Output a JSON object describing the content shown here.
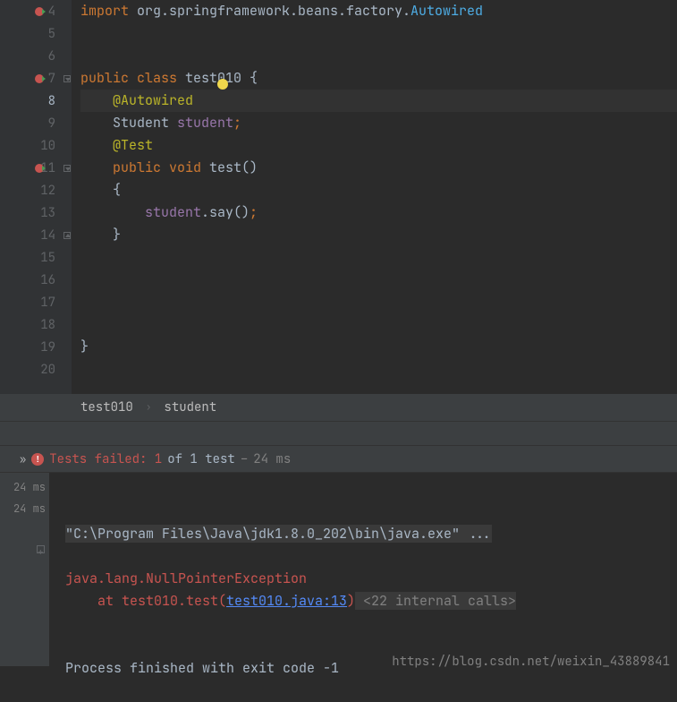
{
  "editor": {
    "lines": [
      {
        "num": 4,
        "run": true,
        "fold": null,
        "seg": [
          [
            "kw-orange",
            "import "
          ],
          [
            "kw-white",
            "org.springframework.beans.factory."
          ],
          [
            "kw-cyan",
            "Autowired"
          ]
        ]
      },
      {
        "num": 5,
        "run": false,
        "fold": null,
        "seg": []
      },
      {
        "num": 6,
        "run": false,
        "fold": null,
        "seg": []
      },
      {
        "num": 7,
        "run": true,
        "fold": "down",
        "seg": [
          [
            "kw-orange",
            "public class "
          ],
          [
            "kw-white",
            "test010 {"
          ]
        ]
      },
      {
        "num": 8,
        "run": false,
        "fold": null,
        "current": true,
        "seg": [
          [
            "kw-white",
            "    "
          ],
          [
            "kw-yellow",
            "@Autowired"
          ]
        ]
      },
      {
        "num": 9,
        "run": false,
        "fold": null,
        "seg": [
          [
            "kw-white",
            "    Student "
          ],
          [
            "kw-purple",
            "student"
          ],
          [
            "kw-orange",
            ";"
          ]
        ]
      },
      {
        "num": 10,
        "run": false,
        "fold": null,
        "seg": [
          [
            "kw-white",
            "    "
          ],
          [
            "kw-yellow",
            "@Test"
          ]
        ]
      },
      {
        "num": 11,
        "run": true,
        "fold": "down",
        "seg": [
          [
            "kw-white",
            "    "
          ],
          [
            "kw-orange",
            "public void "
          ],
          [
            "kw-white",
            "test()"
          ]
        ]
      },
      {
        "num": 12,
        "run": false,
        "fold": null,
        "seg": [
          [
            "kw-white",
            "    {"
          ]
        ]
      },
      {
        "num": 13,
        "run": false,
        "fold": null,
        "seg": [
          [
            "kw-white",
            "        "
          ],
          [
            "kw-purple",
            "student"
          ],
          [
            "kw-white",
            ".say()"
          ],
          [
            "kw-orange",
            ";"
          ]
        ]
      },
      {
        "num": 14,
        "run": false,
        "fold": "up",
        "seg": [
          [
            "kw-white",
            "    }"
          ]
        ]
      },
      {
        "num": 15,
        "run": false,
        "fold": null,
        "seg": []
      },
      {
        "num": 16,
        "run": false,
        "fold": null,
        "seg": []
      },
      {
        "num": 17,
        "run": false,
        "fold": null,
        "seg": []
      },
      {
        "num": 18,
        "run": false,
        "fold": null,
        "seg": []
      },
      {
        "num": 19,
        "run": false,
        "fold": null,
        "seg": [
          [
            "kw-white",
            "}"
          ]
        ]
      },
      {
        "num": 20,
        "run": false,
        "fold": null,
        "seg": []
      }
    ]
  },
  "breadcrumb": {
    "class": "test010",
    "field": "student",
    "sep": "›"
  },
  "test": {
    "chev": "»",
    "status": "Tests failed: 1",
    "of": " of 1 test ",
    "dash": "– ",
    "time": "24 ms"
  },
  "outputGutter": [
    "24 ms",
    "24 ms"
  ],
  "console": {
    "cmd": "\"C:\\Program Files\\Java\\jdk1.8.0_202\\bin\\java.exe\" ...",
    "blank1": "",
    "exc": "java.lang.NullPointerException",
    "at": "    at test010.test(",
    "link": "test010.java:13",
    "paren": ")",
    "internal": " <22 internal calls>",
    "blank2": "",
    "blank3": "",
    "exit": "Process finished with exit code -1"
  },
  "watermark": "https://blog.csdn.net/weixin_43889841"
}
